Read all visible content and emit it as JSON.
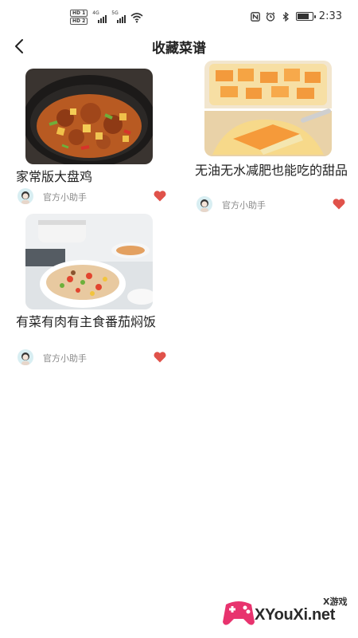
{
  "status_bar": {
    "hd_badges": [
      "HD 1",
      "HD 2"
    ],
    "network_1": "4G",
    "network_2": "5G",
    "time": "2:33",
    "icons": [
      "nfc-icon",
      "alarm-icon",
      "bluetooth-icon",
      "battery-icon"
    ]
  },
  "nav": {
    "title": "收藏菜谱",
    "back_icon": "chevron-left-icon"
  },
  "recipes": [
    {
      "title": "家常版大盘鸡",
      "author": "官方小助手",
      "favorited": true
    },
    {
      "title": "无油无水减肥也能吃的甜品",
      "author": "官方小助手",
      "favorited": true
    },
    {
      "title": "有菜有肉有主食番茄焖饭",
      "author": "官方小助手",
      "favorited": true
    }
  ],
  "colors": {
    "heart": "#e0524a",
    "meta_text": "#8a8a8a",
    "title_text": "#222222"
  },
  "watermark": {
    "small": "X游戏",
    "big": "XYouXi.net"
  }
}
